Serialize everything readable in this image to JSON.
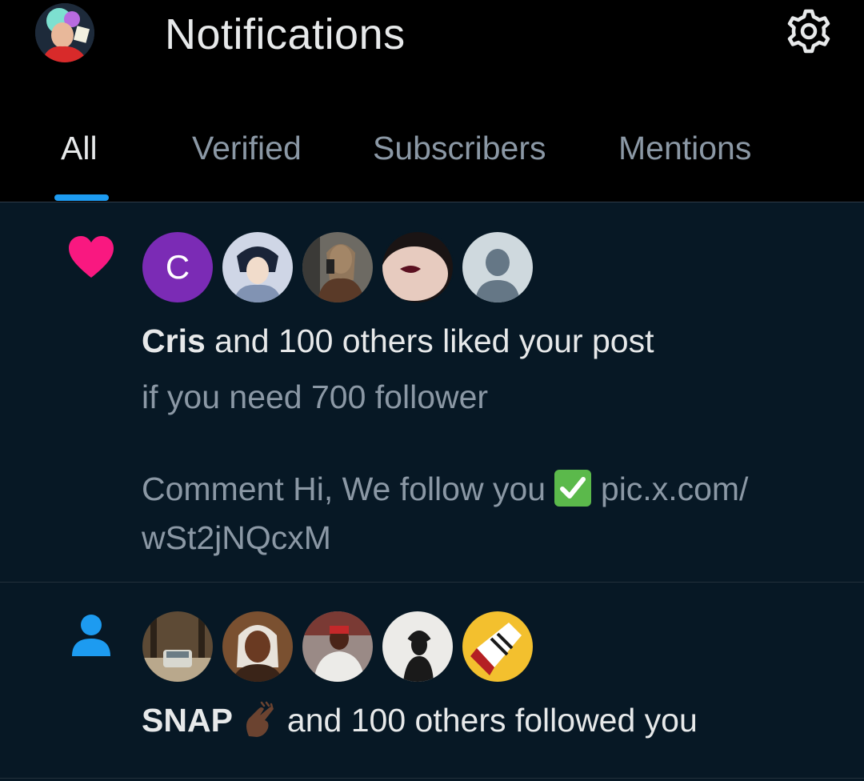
{
  "header": {
    "title": "Notifications",
    "icons": {
      "settings": "gear-icon",
      "profile": "avatar"
    }
  },
  "tabs": [
    {
      "label": "All",
      "active": true
    },
    {
      "label": "Verified",
      "active": false
    },
    {
      "label": "Subscribers",
      "active": false
    },
    {
      "label": "Mentions",
      "active": false
    }
  ],
  "notifications": [
    {
      "type": "like",
      "icon": "heart-icon",
      "icon_color": "#f91880",
      "avatars": [
        {
          "kind": "letter",
          "letter": "C"
        },
        {
          "kind": "photo"
        },
        {
          "kind": "photo"
        },
        {
          "kind": "photo"
        },
        {
          "kind": "default"
        }
      ],
      "actor": "Cris",
      "action_text": "and 100 others liked your post",
      "post_line1": "if you need 700 follower",
      "post_line2_before": "Comment Hi,  We follow you",
      "post_line2_emoji": "check-mark-emoji",
      "post_line2_after": "pic.x.com/",
      "post_line3": "wSt2jNQcxM"
    },
    {
      "type": "follow",
      "icon": "person-icon",
      "icon_color": "#1d9bf0",
      "avatars": [
        {
          "kind": "photo"
        },
        {
          "kind": "photo"
        },
        {
          "kind": "photo"
        },
        {
          "kind": "photo"
        },
        {
          "kind": "photo"
        }
      ],
      "actor": "SNAP",
      "actor_emoji": "fingers-snap-emoji",
      "action_text": "and 100 others followed you"
    }
  ],
  "colors": {
    "background": "#000000",
    "feed_background": "#071825",
    "accent": "#1d9bf0",
    "like": "#f91880",
    "text_primary": "#e7e9ea",
    "text_muted": "#8b98a5"
  }
}
